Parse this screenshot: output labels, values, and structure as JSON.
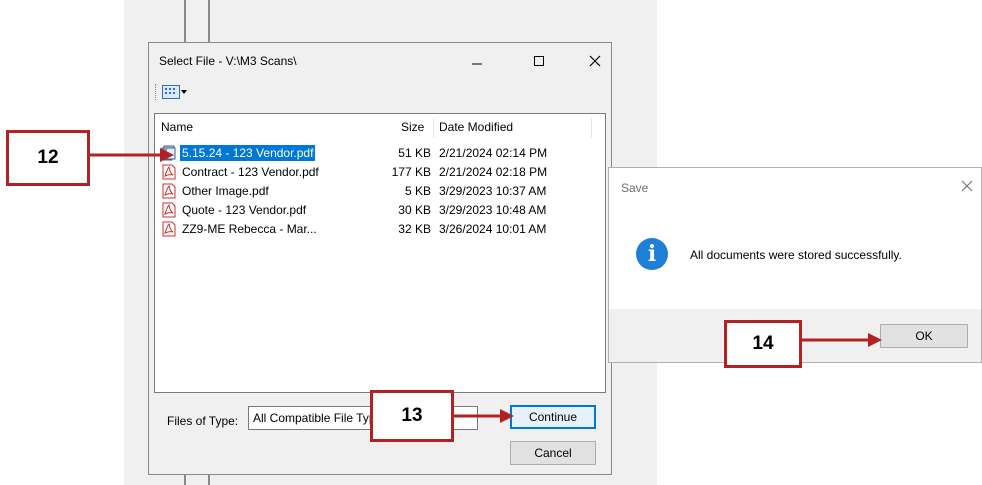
{
  "select_dialog": {
    "title": "Select File - V:\\M3 Scans\\",
    "columns": {
      "name": "Name",
      "size": "Size",
      "date": "Date Modified"
    },
    "files": [
      {
        "name": "5.15.24 - 123 Vendor.pdf",
        "size": "51 KB",
        "date": "2/21/2024 02:14 PM",
        "selected": true,
        "icon": "stack-document-icon"
      },
      {
        "name": "Contract - 123 Vendor.pdf",
        "size": "177 KB",
        "date": "2/21/2024 02:18 PM",
        "selected": false,
        "icon": "pdf-icon"
      },
      {
        "name": "Other Image.pdf",
        "size": "5 KB",
        "date": "3/29/2023 10:37 AM",
        "selected": false,
        "icon": "pdf-icon"
      },
      {
        "name": "Quote - 123 Vendor.pdf",
        "size": "30 KB",
        "date": "3/29/2023 10:48 AM",
        "selected": false,
        "icon": "pdf-icon"
      },
      {
        "name": "ZZ9-ME Rebecca - Mar...",
        "size": "32 KB",
        "date": "3/26/2024 10:01 AM",
        "selected": false,
        "icon": "pdf-icon"
      }
    ],
    "files_of_type_label": "Files of Type:",
    "files_of_type_value": "All Compatible File Types",
    "continue_label": "Continue",
    "cancel_label": "Cancel"
  },
  "save_dialog": {
    "title": "Save",
    "message": "All documents were stored successfully.",
    "ok_label": "OK"
  },
  "callouts": {
    "c12": "12",
    "c13": "13",
    "c14": "14"
  },
  "colors": {
    "callout_border": "#b22222",
    "selection": "#0078d7",
    "info_icon": "#1e7fd6"
  }
}
